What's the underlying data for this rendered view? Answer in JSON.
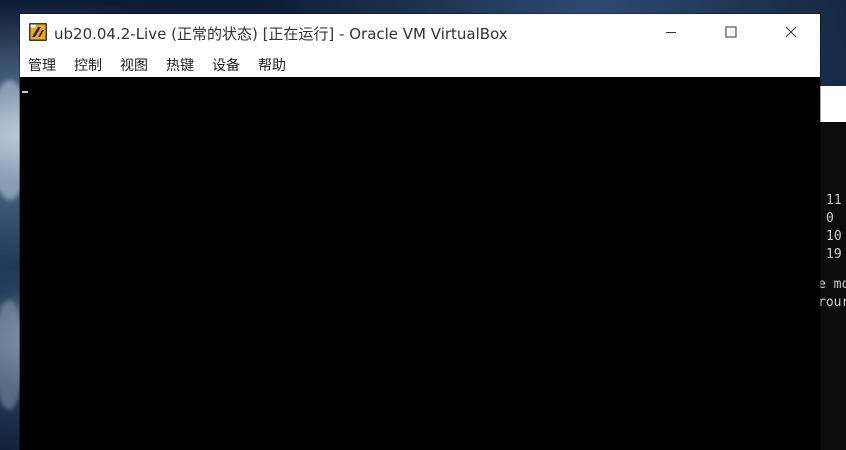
{
  "window": {
    "title": "ub20.04.2-Live (正常的状态) [正在运行] - Oracle VM VirtualBox",
    "controls": {
      "minimize_icon": "minimize-icon",
      "maximize_icon": "maximize-icon",
      "close_icon": "close-icon"
    },
    "app_icon": "virtualbox-app-icon"
  },
  "menubar": {
    "items": [
      {
        "label": "管理"
      },
      {
        "label": "控制"
      },
      {
        "label": "视图"
      },
      {
        "label": "热键"
      },
      {
        "label": "设备"
      },
      {
        "label": "帮助"
      }
    ]
  },
  "vm_screen": {
    "cursor": "_"
  },
  "background_terminal": {
    "lines": [
      {
        "text": "11"
      },
      {
        "text": "0"
      },
      {
        "text": "10"
      },
      {
        "text": "19"
      },
      {
        "text": "e mo"
      },
      {
        "text": "rour"
      }
    ]
  },
  "colors": {
    "vm_screen": "#000000",
    "titlebar": "#ffffff",
    "menu_text": "#222222"
  }
}
